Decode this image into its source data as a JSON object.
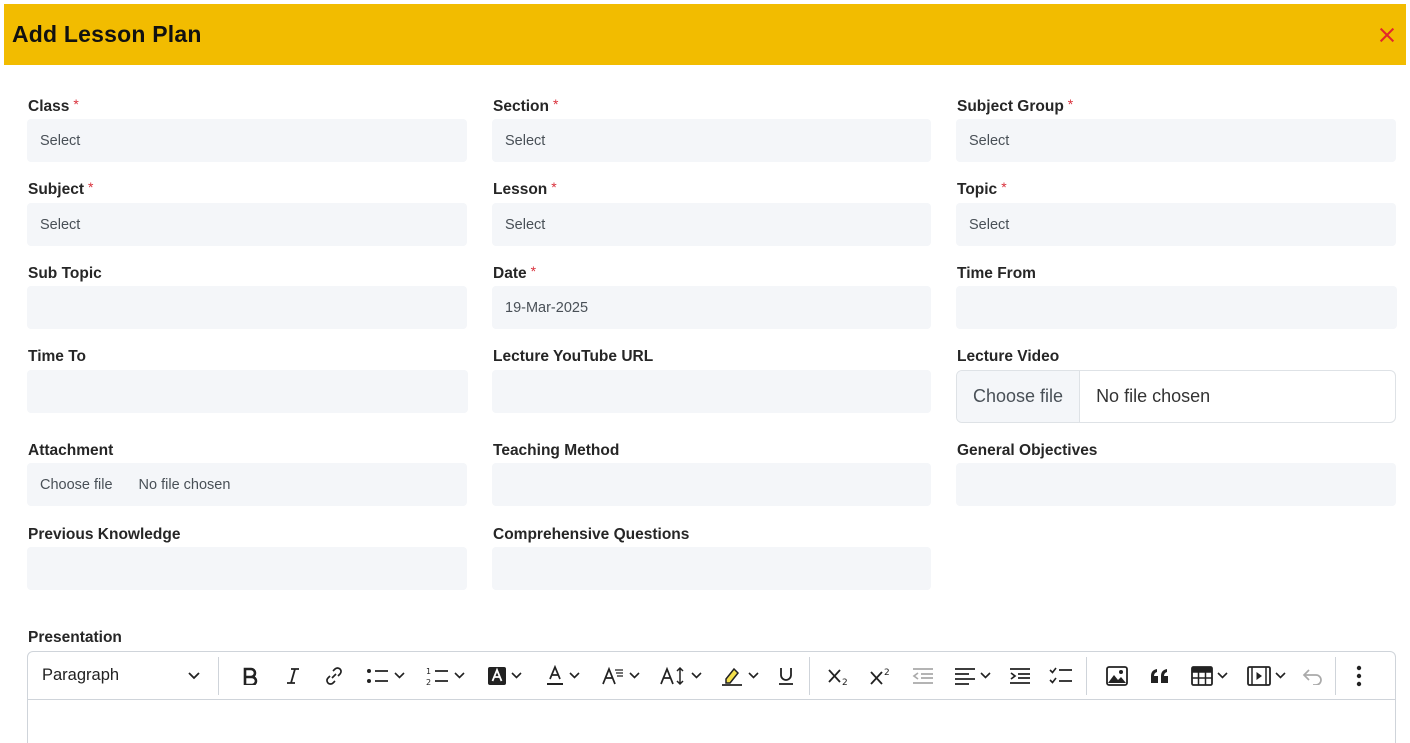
{
  "modal": {
    "title": "Add Lesson Plan"
  },
  "required_mark": "*",
  "fields": {
    "class": {
      "label": "Class",
      "value": "Select"
    },
    "section": {
      "label": "Section",
      "value": "Select"
    },
    "subject_group": {
      "label": "Subject Group",
      "value": "Select"
    },
    "subject": {
      "label": "Subject",
      "value": "Select"
    },
    "lesson": {
      "label": "Lesson",
      "value": "Select"
    },
    "topic": {
      "label": "Topic",
      "value": "Select"
    },
    "sub_topic": {
      "label": "Sub Topic",
      "value": ""
    },
    "date": {
      "label": "Date",
      "value": "19-Mar-2025"
    },
    "time_from": {
      "label": "Time From",
      "value": ""
    },
    "time_to": {
      "label": "Time To",
      "value": ""
    },
    "youtube_url": {
      "label": "Lecture YouTube URL",
      "value": ""
    },
    "lecture_video": {
      "label": "Lecture Video",
      "button": "Choose file",
      "status": "No file chosen"
    },
    "attachment": {
      "label": "Attachment",
      "button": "Choose file",
      "status": "No file chosen"
    },
    "teaching_method": {
      "label": "Teaching Method",
      "value": ""
    },
    "general_objectives": {
      "label": "General Objectives",
      "value": ""
    },
    "previous_knowledge": {
      "label": "Previous Knowledge",
      "value": ""
    },
    "comprehensive_questions": {
      "label": "Comprehensive Questions",
      "value": ""
    },
    "presentation": {
      "label": "Presentation"
    }
  },
  "editor": {
    "block_format": "Paragraph"
  },
  "colors": {
    "header": "#f2bc00",
    "close": "#e3262b",
    "input_bg": "#f4f6f9",
    "required": "#d9303b"
  }
}
